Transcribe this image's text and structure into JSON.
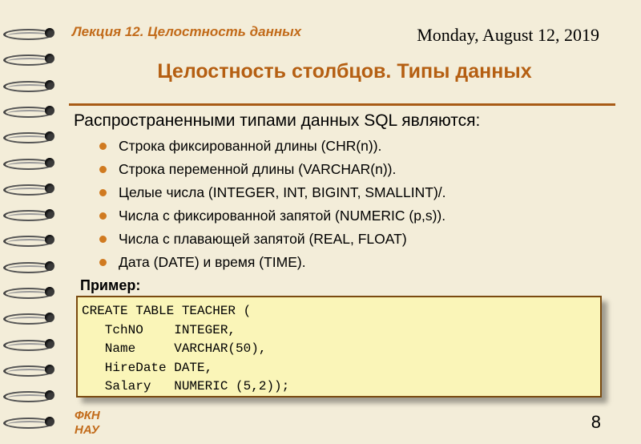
{
  "header": {
    "lecture_title": "Лекция 12.  Целостность данных",
    "date": "Monday, August 12, 2019"
  },
  "slide": {
    "title": "Целостность столбцов. Типы данных",
    "intro": "Распространенными типами данных SQL являются:",
    "bullets": [
      "Строка фиксированной длины (CHR(n)).",
      "Строка переменной длины (VARCHAR(n)).",
      "Целые числа (INTEGER, INT, BIGINT, SMALLINT)/.",
      "Числа с фиксированной запятой (NUMERIC (p,s)).",
      "Числа с плавающей запятой (REAL, FLOAT)",
      "Дата (DATE) и время (TIME)."
    ],
    "example_label": "Пример:",
    "code_lines": [
      "CREATE TABLE TEACHER (",
      "   TchNO    INTEGER,",
      "   Name     VARCHAR(50),",
      "   HireDate DATE,",
      "   Salary   NUMERIC (5,2));"
    ]
  },
  "footer": {
    "left_line1": "ФКН",
    "left_line2": "НАУ",
    "page_number": "8"
  },
  "colors": {
    "background": "#f3edd9",
    "accent": "#c26b1a",
    "rule": "#a85b16",
    "code_bg": "#faf5b8",
    "bullet": "#d07a20"
  }
}
